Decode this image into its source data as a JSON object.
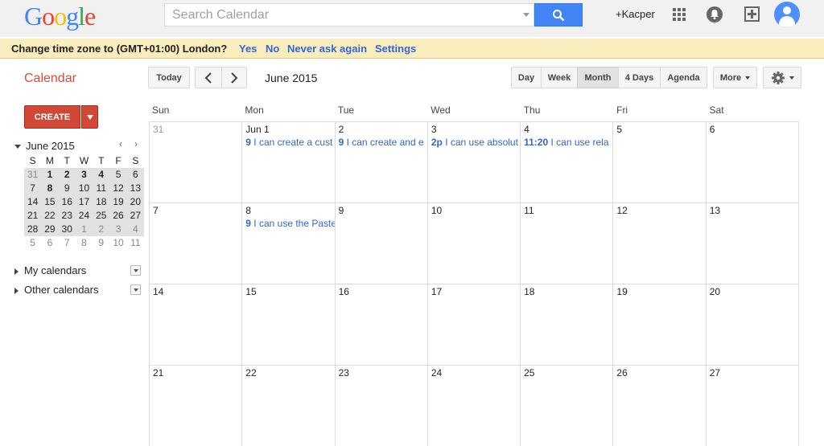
{
  "logo": {
    "letters": [
      "G",
      "o",
      "o",
      "g",
      "l",
      "e"
    ],
    "colors": [
      "#4285f4",
      "#ea4335",
      "#fbbc05",
      "#4285f4",
      "#34a853",
      "#ea4335"
    ]
  },
  "search": {
    "placeholder": "Search Calendar"
  },
  "header": {
    "user": "+Kacper"
  },
  "tzbar": {
    "message": "Change time zone to (GMT+01:00) London?",
    "yes": "Yes",
    "no": "No",
    "never": "Never ask again",
    "settings": "Settings"
  },
  "toolbar": {
    "app_title": "Calendar",
    "today": "Today",
    "month_title": "June 2015",
    "views": {
      "day": "Day",
      "week": "Week",
      "month": "Month",
      "four_days": "4 Days",
      "agenda": "Agenda"
    },
    "more": "More"
  },
  "sidebar": {
    "create": "CREATE",
    "mini_title": "June 2015",
    "mini_dows": [
      "S",
      "M",
      "T",
      "W",
      "T",
      "F",
      "S"
    ],
    "mini_weeks": [
      [
        "31",
        "1",
        "2",
        "3",
        "4",
        "5",
        "6"
      ],
      [
        "7",
        "8",
        "9",
        "10",
        "11",
        "12",
        "13"
      ],
      [
        "14",
        "15",
        "16",
        "17",
        "18",
        "19",
        "20"
      ],
      [
        "21",
        "22",
        "23",
        "24",
        "25",
        "26",
        "27"
      ],
      [
        "28",
        "29",
        "30",
        "1",
        "2",
        "3",
        "4"
      ],
      [
        "5",
        "6",
        "7",
        "8",
        "9",
        "10",
        "11"
      ]
    ],
    "my_calendars": "My calendars",
    "other_calendars": "Other calendars"
  },
  "month": {
    "dows": [
      "Sun",
      "Mon",
      "Tue",
      "Wed",
      "Thu",
      "Fri",
      "Sat"
    ],
    "weeks": [
      [
        {
          "day": "31",
          "dim": true
        },
        {
          "day": "Jun 1",
          "events": [
            {
              "time": "9",
              "text": "I can create a cust"
            }
          ]
        },
        {
          "day": "2",
          "events": [
            {
              "time": "9",
              "text": "I can create and e"
            }
          ]
        },
        {
          "day": "3",
          "events": [
            {
              "time": "2p",
              "text": "I can use absolut"
            }
          ]
        },
        {
          "day": "4",
          "events": [
            {
              "time": "11:20",
              "text": "I can use rela"
            }
          ]
        },
        {
          "day": "5"
        },
        {
          "day": "6"
        }
      ],
      [
        {
          "day": "7"
        },
        {
          "day": "8",
          "events": [
            {
              "time": "9",
              "text": "I can use the Paste"
            }
          ]
        },
        {
          "day": "9"
        },
        {
          "day": "10"
        },
        {
          "day": "11"
        },
        {
          "day": "12"
        },
        {
          "day": "13"
        }
      ],
      [
        {
          "day": "14"
        },
        {
          "day": "15"
        },
        {
          "day": "16"
        },
        {
          "day": "17"
        },
        {
          "day": "18"
        },
        {
          "day": "19"
        },
        {
          "day": "20"
        }
      ],
      [
        {
          "day": "21"
        },
        {
          "day": "22"
        },
        {
          "day": "23"
        },
        {
          "day": "24"
        },
        {
          "day": "25"
        },
        {
          "day": "26"
        },
        {
          "day": "27"
        }
      ]
    ]
  }
}
